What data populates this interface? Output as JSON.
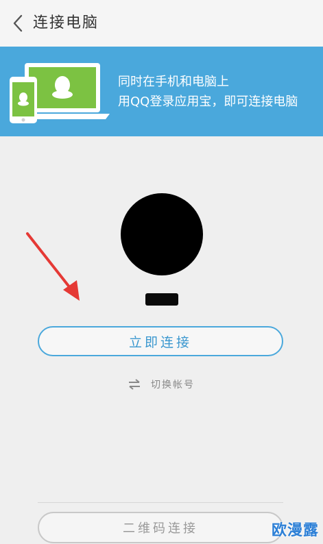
{
  "header": {
    "title": "连接电脑",
    "back_icon": "back-chevron-icon"
  },
  "banner": {
    "line1": "同时在手机和电脑上",
    "line2": "用QQ登录应用宝，即可连接电脑",
    "background": "#4aa8dc",
    "illustration_icon": "qq-phone-laptop-illustration"
  },
  "account": {
    "avatar_icon": "avatar",
    "nickname": ""
  },
  "actions": {
    "connect_label": "立即连接",
    "switch_label": "切换帐号",
    "switch_icon": "swap-arrows-icon",
    "qr_label": "二维码连接"
  },
  "annotation": {
    "arrow_color": "#e53935"
  },
  "watermark": {
    "text": "欧漫露"
  }
}
